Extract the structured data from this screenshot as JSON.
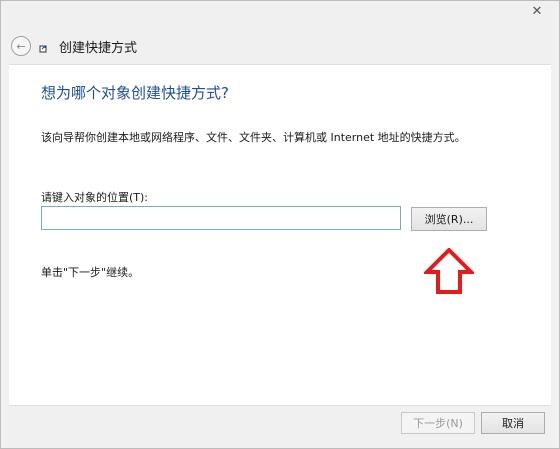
{
  "window": {
    "close_icon": "✕"
  },
  "header": {
    "back_icon": "←",
    "wizard_icon": "shortcut-wizard-icon",
    "title": "创建快捷方式"
  },
  "main": {
    "heading": "想为哪个对象创建快捷方式?",
    "description": "该向导帮你创建本地或网络程序、文件、文件夹、计算机或 Internet 地址的快捷方式。",
    "location_label": "请键入对象的位置(T):",
    "location_value": "",
    "browse_label": "浏览(R)...",
    "continue_note": "单击\"下一步\"继续。",
    "annotation_arrow_color": "#e31b1b"
  },
  "footer": {
    "next_label": "下一步(N)",
    "cancel_label": "取消"
  }
}
